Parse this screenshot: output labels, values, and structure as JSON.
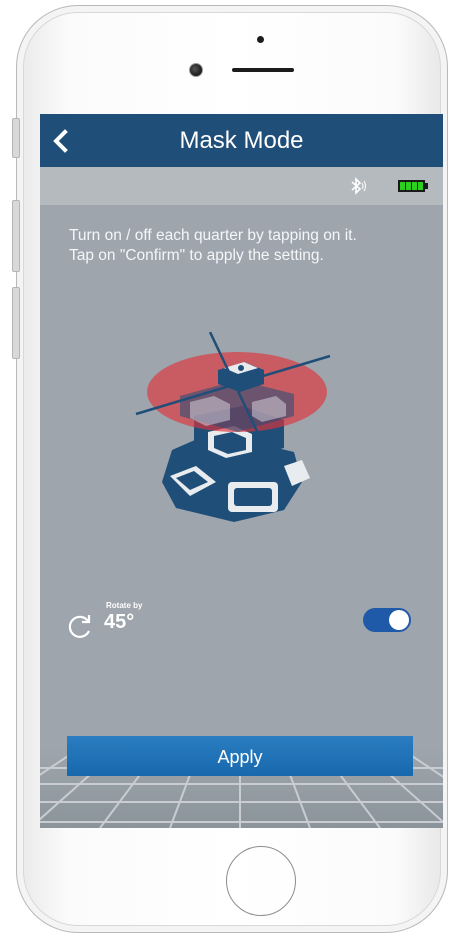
{
  "navbar": {
    "back_icon": "chevron-left-icon",
    "title": "Mask Mode"
  },
  "status": {
    "bluetooth_icon": "bluetooth-icon",
    "battery_icon": "battery-icon",
    "battery_color": "#2bd11e"
  },
  "instructions": {
    "line1": "Turn on / off each quarter by tapping on it.",
    "line2": "Tap on \"Confirm\" to apply the setting."
  },
  "device_art": {
    "icon": "laser-level-device-icon",
    "mask_color": "#e0333a"
  },
  "rotate": {
    "icon": "rotate-icon",
    "caption": "Rotate by",
    "value": "45°",
    "toggle_on": true
  },
  "apply": {
    "label": "Apply"
  },
  "colors": {
    "navbar": "#1f4e79",
    "background": "#9ea5ad",
    "accent": "#1f5aa8"
  }
}
